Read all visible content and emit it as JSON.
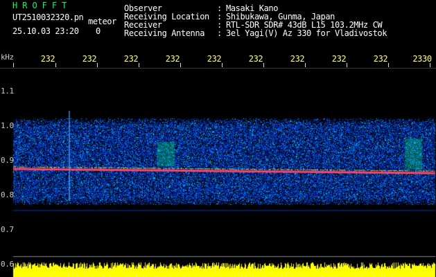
{
  "header": {
    "title": "HROFFT",
    "file_name": "UT2510032320.pn",
    "type": "meteor",
    "date_time": "25.10.03 23:20",
    "seconds": "0",
    "title_color": "#00ff66",
    "text_color": "#ffffff",
    "meteor_color": "#ffffff"
  },
  "meta": [
    {
      "label": "Observer",
      "value": "Masaki Kano"
    },
    {
      "label": "Receiving Location",
      "value": "Shibukawa, Gunma, Japan"
    },
    {
      "label": "Receiver",
      "value": "RTL-SDR SDR# 43dB L15 103.2MHz CW"
    },
    {
      "label": "Receiving Antenna",
      "value": "3el Yagi(V) Az 330 for Vladivostok"
    }
  ],
  "axis": {
    "unit_label": "kHz",
    "time_ticks": [
      "232",
      "232",
      "232",
      "232",
      "232",
      "232",
      "232",
      "232",
      "232",
      "2330"
    ],
    "freq_ticks": [
      "1.1",
      "1.0",
      "0.9",
      "0.8",
      "0.7",
      "0.6"
    ],
    "tick_color": "#ffff88",
    "axis_text_color": "#cccccc"
  },
  "waterfall": {
    "band_low_khz": 0.77,
    "band_high_khz": 1.02,
    "carrier_khz": 0.875,
    "noise_line_khz": 0.755,
    "bottom_band_color": "#ffff00",
    "carrier_color": "#ff4466",
    "noise_colors": [
      "#001a66",
      "#0033cc",
      "#0066ff",
      "#00b3ff",
      "#22ff88"
    ]
  }
}
